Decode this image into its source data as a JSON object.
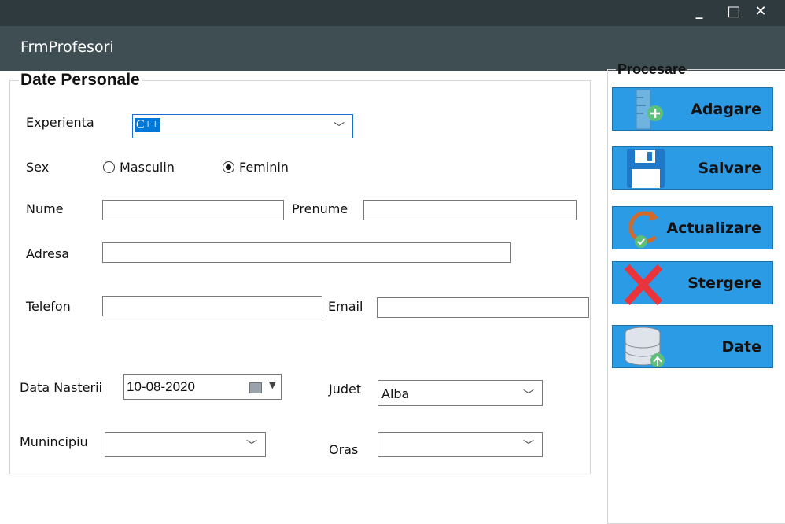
{
  "window": {
    "title": "FrmProfesori",
    "minimize_glyph": "_",
    "maximize_glyph": "□",
    "close_glyph": "✕"
  },
  "personal": {
    "legend": "Date Personale",
    "experienta": {
      "label": "Experienta",
      "value": "C++"
    },
    "sex": {
      "label": "Sex",
      "options": [
        "Masculin",
        "Feminin"
      ],
      "selected": "Feminin"
    },
    "nume": {
      "label": "Nume",
      "value": ""
    },
    "prenume": {
      "label": "Prenume",
      "value": ""
    },
    "adresa": {
      "label": "Adresa",
      "value": ""
    },
    "telefon": {
      "label": "Telefon",
      "value": ""
    },
    "email": {
      "label": "Email",
      "value": ""
    },
    "data_nasterii": {
      "label": "Data Nasterii",
      "value": "10-08-2020"
    },
    "judet": {
      "label": "Judet",
      "value": "Alba"
    },
    "municipiu": {
      "label": "Munincipiu",
      "value": ""
    },
    "oras": {
      "label": "Oras",
      "value": ""
    }
  },
  "procesare": {
    "legend": "Procesare",
    "buttons": [
      {
        "label": "Adagare",
        "icon": "add-ruler-icon"
      },
      {
        "label": "Salvare",
        "icon": "floppy-disk-icon"
      },
      {
        "label": "Actualizare",
        "icon": "refresh-icon"
      },
      {
        "label": "Stergere",
        "icon": "delete-x-icon"
      },
      {
        "label": "Date",
        "icon": "database-upload-icon"
      }
    ]
  },
  "colors": {
    "titlebar": "#2e3a3d",
    "header": "#3f4e52",
    "button_blue": "#2c9be6",
    "selection": "#0078d7"
  }
}
